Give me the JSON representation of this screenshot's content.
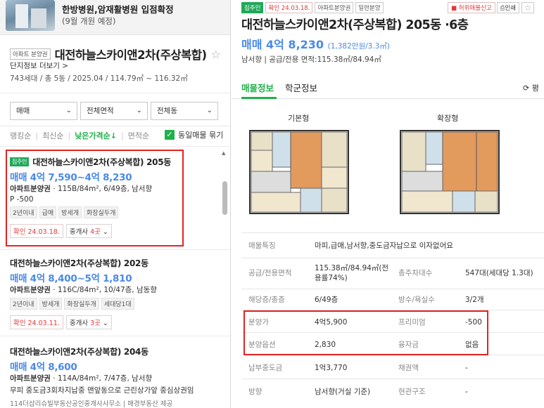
{
  "banner": {
    "title": "한방병원,암재활병원 입점확정",
    "subtitle": "(9월 개원 예정)"
  },
  "complex": {
    "type_tag": "아파트 분양권",
    "name": "대전하늘스카이앤2차(주상복합)",
    "detail_link": "단지정보 더보기 >",
    "summary": "743세대 / 총 5동 / 2025.04 / 114.79㎡ ~ 116.32㎡"
  },
  "filters": {
    "trade": "매매",
    "area": "전체면적",
    "dong": "전체동"
  },
  "sort": {
    "options": [
      "랭킹순",
      "최신순",
      "낮은가격순↓",
      "면적순"
    ],
    "active": "낮은가격순↓",
    "same_listing_label": "동일매물 묶기"
  },
  "listings": [
    {
      "badge": "집주인",
      "title": "대전하늘스카이앤2차(주상복합) 205동",
      "price": "매매 4억 7,590~4억 8,230",
      "desc_type": "아파트분양권",
      "desc": " · 115B/84m², 6/49층, 남서향",
      "extra": "P -500",
      "tags": [
        "2년이내",
        "급매",
        "방세개",
        "화장실두개"
      ],
      "confirm_date": "확인 24.03.18.",
      "agent_prefix": "중개사 ",
      "agent_count": "4곳"
    },
    {
      "badge": "",
      "title": "대전하늘스카이앤2차(주상복합) 202동",
      "price": "매매 4억 8,400~5억 1,810",
      "desc_type": "아파트분양권",
      "desc": " · 116C/84m², 10/47층, 남동향",
      "extra": "",
      "tags": [
        "2년이내",
        "방세개",
        "화장실두개",
        "세대당1대"
      ],
      "confirm_date": "확인 24.03.11.",
      "agent_prefix": "중개사 ",
      "agent_count": "3곳"
    },
    {
      "badge": "",
      "title": "대전하늘스카이앤2차(주상복합) 204동",
      "price": "매매 4억 8,600",
      "desc_type": "아파트분양권",
      "desc": " · 114A/84m², 7/47층, 남서향",
      "extra": "무피 중도금3회차지납중 맨앞동으로 근린상가앞 중심상권임",
      "extra2": "114더샵리슈빌부동산공인중개사사무소 | 매경부동산 제공",
      "tags": [],
      "confirm_date": "",
      "agent_prefix": "",
      "agent_count": ""
    }
  ],
  "detail": {
    "tags": [
      "집주인",
      "확인 24.03.18.",
      "아파트분양권",
      "일반분양"
    ],
    "report_label": "허위매물신고",
    "print_label": "인쇄",
    "title": "대전하늘스카이앤2차(주상복합) 205동 ·6층",
    "price": "매매 4억 8,230",
    "price_unit": "(1,382만원/3.3㎡)",
    "subtitle": "남서향  |  공급/전용 면적:115.38㎡/84.94㎡",
    "tabs": [
      "매물정보",
      "학군정보"
    ],
    "refresh_label": "⟳ 평",
    "plans": [
      "기본형",
      "확장형"
    ],
    "rows": [
      {
        "l1": "매물특징",
        "v1": "마피,급매,남서향,중도금자납으로 이자없어요",
        "l2": "",
        "v2": ""
      },
      {
        "l1": "공급/전용면적",
        "v1": "115.38㎡/84.94㎡(전용률74%)",
        "l2": "총주차대수",
        "v2": "547대(세대당 1.3대)"
      },
      {
        "l1": "해당층/총층",
        "v1": "6/49층",
        "l2": "방수/욕실수",
        "v2": "3/2개"
      },
      {
        "l1": "분양가",
        "v1": "4억5,900",
        "l2": "프리미엄",
        "v2": "-500"
      },
      {
        "l1": "분양옵션",
        "v1": "2,830",
        "l2": "융자금",
        "v2": "없음"
      },
      {
        "l1": "납부중도금",
        "v1": "1억3,770",
        "l2": "채권액",
        "v2": "-"
      },
      {
        "l1": "방향",
        "v1": "남서향(거실 기준)",
        "l2": "현관구조",
        "v2": "-"
      }
    ]
  }
}
